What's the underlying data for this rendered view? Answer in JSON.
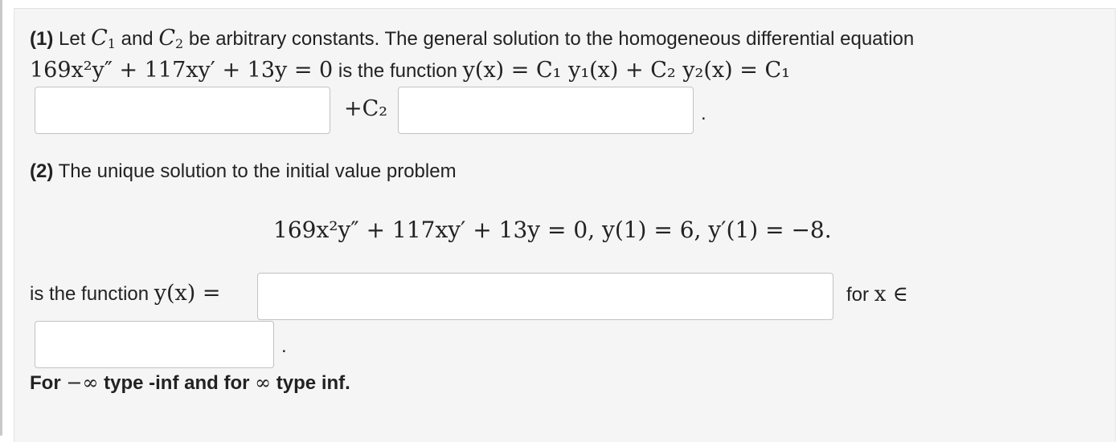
{
  "part1": {
    "label": "(1)",
    "text_intro": "Let",
    "c1": "C",
    "c1_sub": "1",
    "and": "and",
    "c2": "C",
    "c2_sub": "2",
    "text_rest": "be arbitrary constants. The general solution to the homogeneous differential equation",
    "equation": "169x²y″ + 117xy′ + 13y = 0",
    "is_the_function": "is the function",
    "general_expr": "y(x) = C₁ y₁(x) + C₂ y₂(x) = C₁",
    "plus_c2": "+C₂",
    "period": ".",
    "input1_value": "",
    "input2_value": ""
  },
  "part2": {
    "label": "(2)",
    "text": "The unique solution to the initial value problem",
    "ivp": "169x²y″ + 117xy′ + 13y = 0,  y(1) = 6,  y′(1) = −8.",
    "is_the_function": "is the function",
    "y_of_x_eq": "y(x) =",
    "for_text": "for",
    "x_in": "x ∈",
    "period": ".",
    "solution_value": "",
    "interval_value": ""
  },
  "hint": {
    "for": "For",
    "neg_inf": "−∞",
    "type_neg": "type -inf and for",
    "pos_inf": "∞",
    "type_pos": "type inf."
  }
}
